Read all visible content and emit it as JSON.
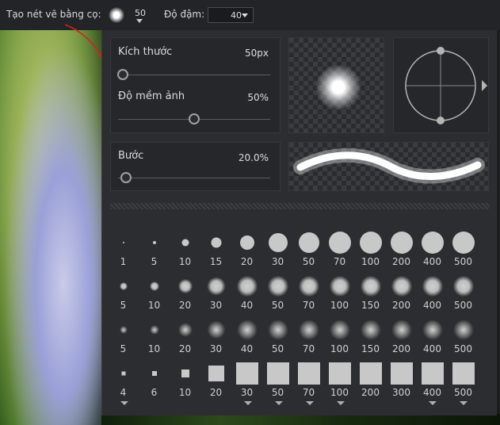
{
  "toolbar": {
    "stroke_label": "Tạo nét vẽ bằng cọ:",
    "brush_size": "50",
    "opacity_label": "Độ đậm:",
    "opacity_value": "40"
  },
  "panel": {
    "size_label": "Kích thước",
    "size_value": "50px",
    "size_fraction": 0.03,
    "softness_label": "Độ mềm ảnh",
    "softness_value": "50%",
    "softness_fraction": 0.5,
    "step_label": "Bước",
    "step_value": "20.0%",
    "step_fraction": 0.05
  },
  "presets": [
    {
      "type": "hard-dot",
      "sizes": [
        "1",
        "5",
        "10",
        "15",
        "20",
        "30",
        "50",
        "70",
        "100",
        "200",
        "400",
        "500"
      ]
    },
    {
      "type": "soft-dot",
      "sizes": [
        "5",
        "10",
        "20",
        "30",
        "40",
        "50",
        "70",
        "100",
        "150",
        "200",
        "400",
        "500"
      ]
    },
    {
      "type": "softer-dot",
      "sizes": [
        "5",
        "10",
        "20",
        "30",
        "40",
        "50",
        "70",
        "100",
        "150",
        "200",
        "400",
        "500"
      ]
    },
    {
      "type": "square",
      "sizes": [
        "4",
        "6",
        "10",
        "20",
        "30",
        "50",
        "70",
        "100",
        "200",
        "300",
        "400",
        "500"
      ]
    }
  ],
  "colors": {
    "panel_bg": "#2c2d30",
    "text": "#dcdcdc",
    "shape": "#c8c8c8",
    "annotation_arrow": "#d0241c"
  }
}
